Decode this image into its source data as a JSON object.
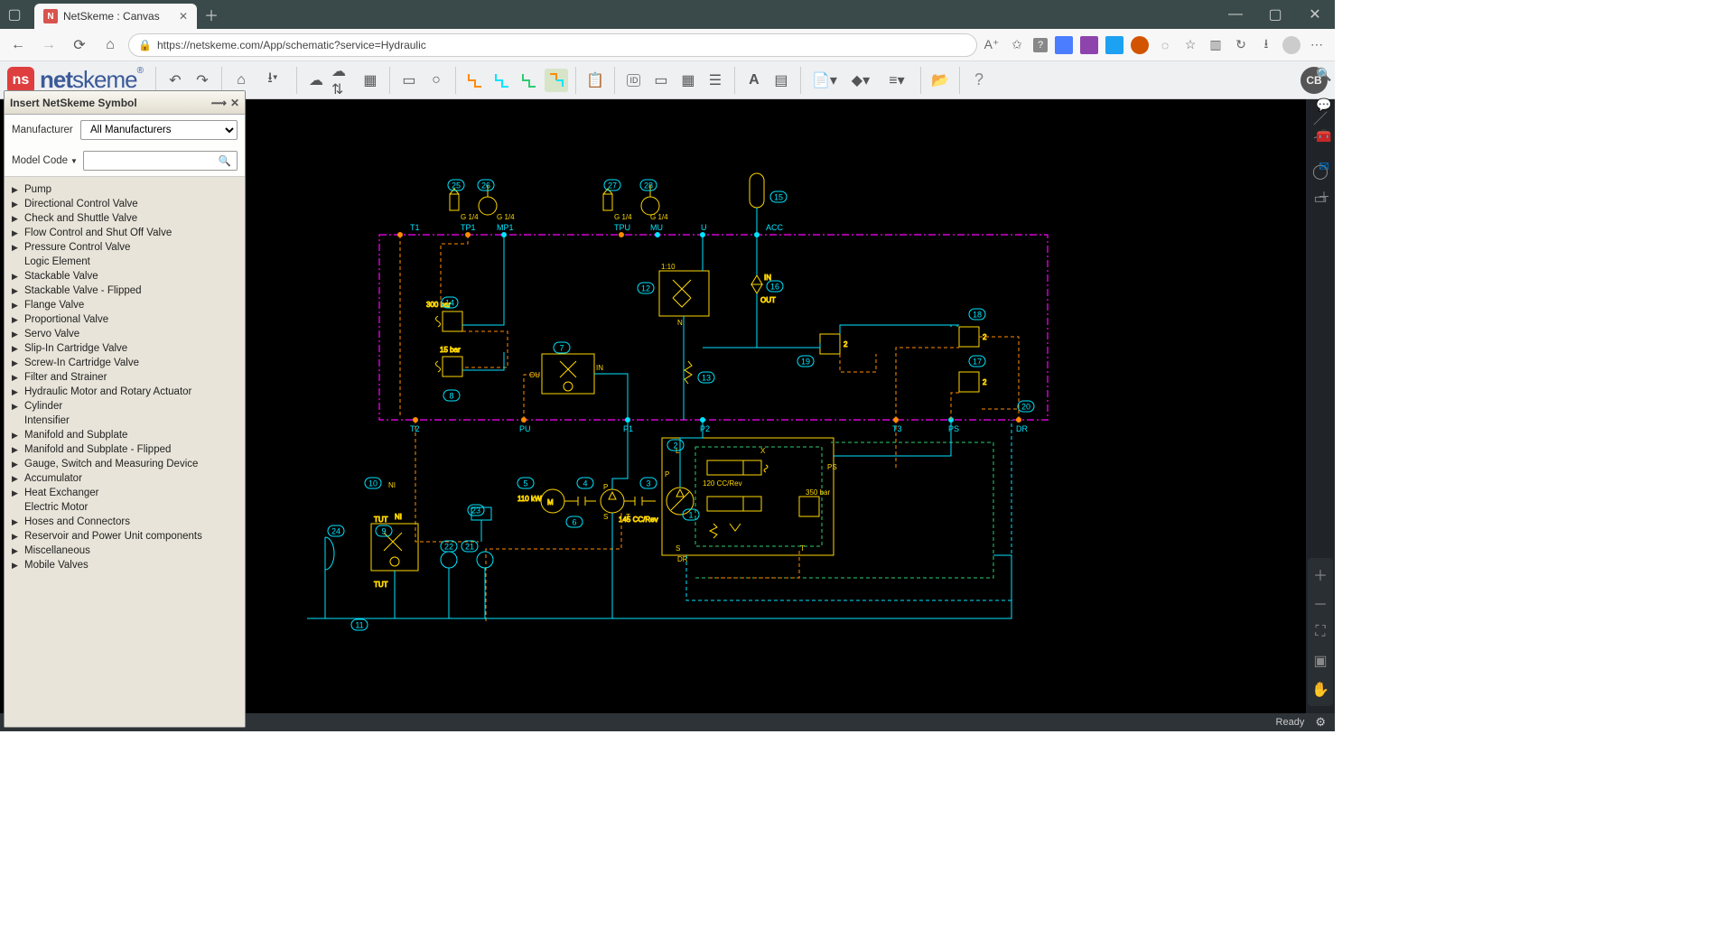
{
  "browser": {
    "tab_title": "NetSkeme : Canvas",
    "url": "https://netskeme.com/App/schematic?service=Hydraulic"
  },
  "brand": {
    "name": "netskeme",
    "logo_bg": "#df3e3e"
  },
  "toolbar": {
    "avatar": "CB"
  },
  "panel": {
    "title": "Insert NetSkeme Symbol",
    "manufacturer_label": "Manufacturer",
    "manufacturer_value": "All Manufacturers",
    "modelcode_label": "Model Code",
    "categories": [
      {
        "label": "Pump",
        "expandable": true
      },
      {
        "label": "Directional Control Valve",
        "expandable": true
      },
      {
        "label": "Check and Shuttle Valve",
        "expandable": true
      },
      {
        "label": "Flow Control and Shut Off Valve",
        "expandable": true
      },
      {
        "label": "Pressure Control Valve",
        "expandable": true
      },
      {
        "label": "Logic Element",
        "expandable": false
      },
      {
        "label": "Stackable Valve",
        "expandable": true
      },
      {
        "label": "Stackable Valve - Flipped",
        "expandable": true
      },
      {
        "label": "Flange Valve",
        "expandable": true
      },
      {
        "label": "Proportional Valve",
        "expandable": true
      },
      {
        "label": "Servo Valve",
        "expandable": true
      },
      {
        "label": "Slip-In Cartridge Valve",
        "expandable": true
      },
      {
        "label": "Screw-In Cartridge Valve",
        "expandable": true
      },
      {
        "label": "Filter and Strainer",
        "expandable": true
      },
      {
        "label": "Hydraulic Motor and Rotary Actuator",
        "expandable": true
      },
      {
        "label": "Cylinder",
        "expandable": true
      },
      {
        "label": "Intensifier",
        "expandable": false
      },
      {
        "label": "Manifold and Subplate",
        "expandable": true
      },
      {
        "label": "Manifold and Subplate - Flipped",
        "expandable": true
      },
      {
        "label": "Gauge, Switch and Measuring Device",
        "expandable": true
      },
      {
        "label": "Accumulator",
        "expandable": true
      },
      {
        "label": "Heat Exchanger",
        "expandable": true
      },
      {
        "label": "Electric Motor",
        "expandable": false
      },
      {
        "label": "Hoses and Connectors",
        "expandable": true
      },
      {
        "label": "Reservoir and Power Unit components",
        "expandable": true
      },
      {
        "label": "Miscellaneous",
        "expandable": true
      },
      {
        "label": "Mobile Valves",
        "expandable": true
      }
    ]
  },
  "schematic": {
    "port_labels": {
      "T1": "T1",
      "T2": "T2",
      "PU": "PU",
      "P1": "P1",
      "P2": "P2",
      "T3": "T3",
      "PS": "PS",
      "DR": "DR",
      "TP1": "TP1",
      "MP1": "MP1",
      "TPU": "TPU",
      "MU": "MU",
      "U": "U",
      "ACC": "ACC",
      "IN": "IN",
      "OUT": "OUT",
      "NI": "NI"
    },
    "gauges": {
      "g1": "G 1/4",
      "g2": "G 1/4",
      "g3": "G 1/4",
      "g4": "G 1/4"
    },
    "annotations": {
      "bar300": "300 bar",
      "bar15": "15 bar",
      "bar350": "350 bar",
      "kw110": "110 kW",
      "ccrev": "145 CC/Rev",
      "ccrev2": "120 CC/Rev",
      "tut1": "TUT",
      "tut2": "TUT"
    },
    "bubbles": [
      "1",
      "2",
      "3",
      "4",
      "5",
      "6",
      "7",
      "8",
      "9",
      "10",
      "11",
      "12",
      "13",
      "14",
      "15",
      "16",
      "17",
      "18",
      "19",
      "20",
      "21",
      "22",
      "23",
      "24",
      "25",
      "26",
      "27",
      "28"
    ]
  },
  "status": {
    "ready": "Ready"
  }
}
